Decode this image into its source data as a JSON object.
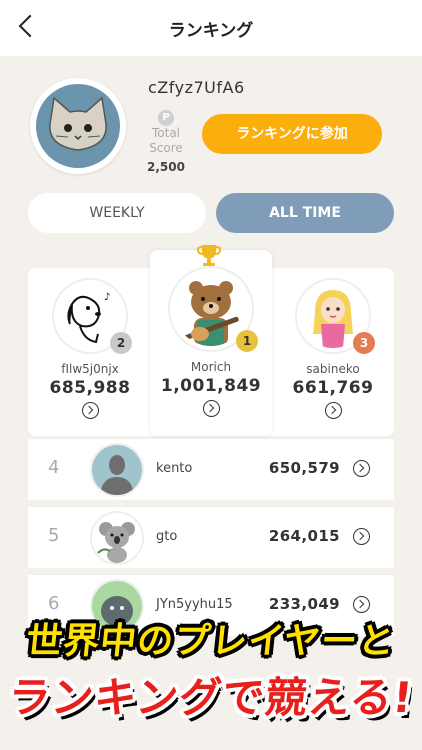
{
  "header": {
    "title": "ランキング"
  },
  "profile": {
    "username": "cZfyz7UfA6",
    "points_icon": "P",
    "total_score_label": "Total Score",
    "total_score": "2,500",
    "join_button": "ランキングに参加"
  },
  "tabs": [
    {
      "label": "WEEKLY",
      "selected": false
    },
    {
      "label": "ALL TIME",
      "selected": true
    }
  ],
  "top3": [
    {
      "rank": "2",
      "name": "fIlw5j0njx",
      "score": "685,988",
      "badge_color": "#c9c9c9"
    },
    {
      "rank": "1",
      "name": "Morich",
      "score": "1,001,849",
      "badge_color": "#e8c23a"
    },
    {
      "rank": "3",
      "name": "sabineko",
      "score": "661,769",
      "badge_color": "#e47b53"
    }
  ],
  "rows": [
    {
      "rank": "4",
      "name": "kento",
      "score": "650,579"
    },
    {
      "rank": "5",
      "name": "gto",
      "score": "264,015"
    },
    {
      "rank": "6",
      "name": "JYn5yyhu15",
      "score": "233,049"
    }
  ],
  "banner": {
    "line1": "世界中のプレイヤーと",
    "line2": "ランキングで競える!"
  },
  "colors": {
    "accent": "#fcae0d",
    "tab_selected": "#7f9db8",
    "background": "#f4f1ec"
  }
}
